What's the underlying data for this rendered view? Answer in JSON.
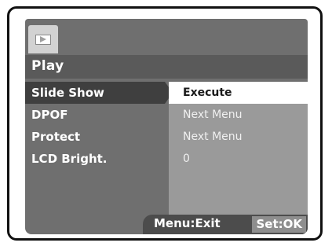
{
  "mode_tab": {
    "icon": "play-mode-icon"
  },
  "header": {
    "title": "Play"
  },
  "menu": {
    "items": [
      {
        "label": "Slide Show",
        "value": "Execute",
        "selected": true
      },
      {
        "label": "DPOF",
        "value": "Next Menu",
        "selected": false
      },
      {
        "label": "Protect",
        "value": "Next Menu",
        "selected": false
      },
      {
        "label": "LCD Bright.",
        "value": "0",
        "selected": false
      }
    ]
  },
  "footer": {
    "exit_label": "Menu:Exit",
    "ok_label": "Set:OK"
  },
  "colors": {
    "panel": "#6f6f6f",
    "header": "#5a5a5a",
    "selected_row": "#3f3f3f",
    "value_column": "#9a9a9a",
    "selected_value": "#ffffff"
  }
}
